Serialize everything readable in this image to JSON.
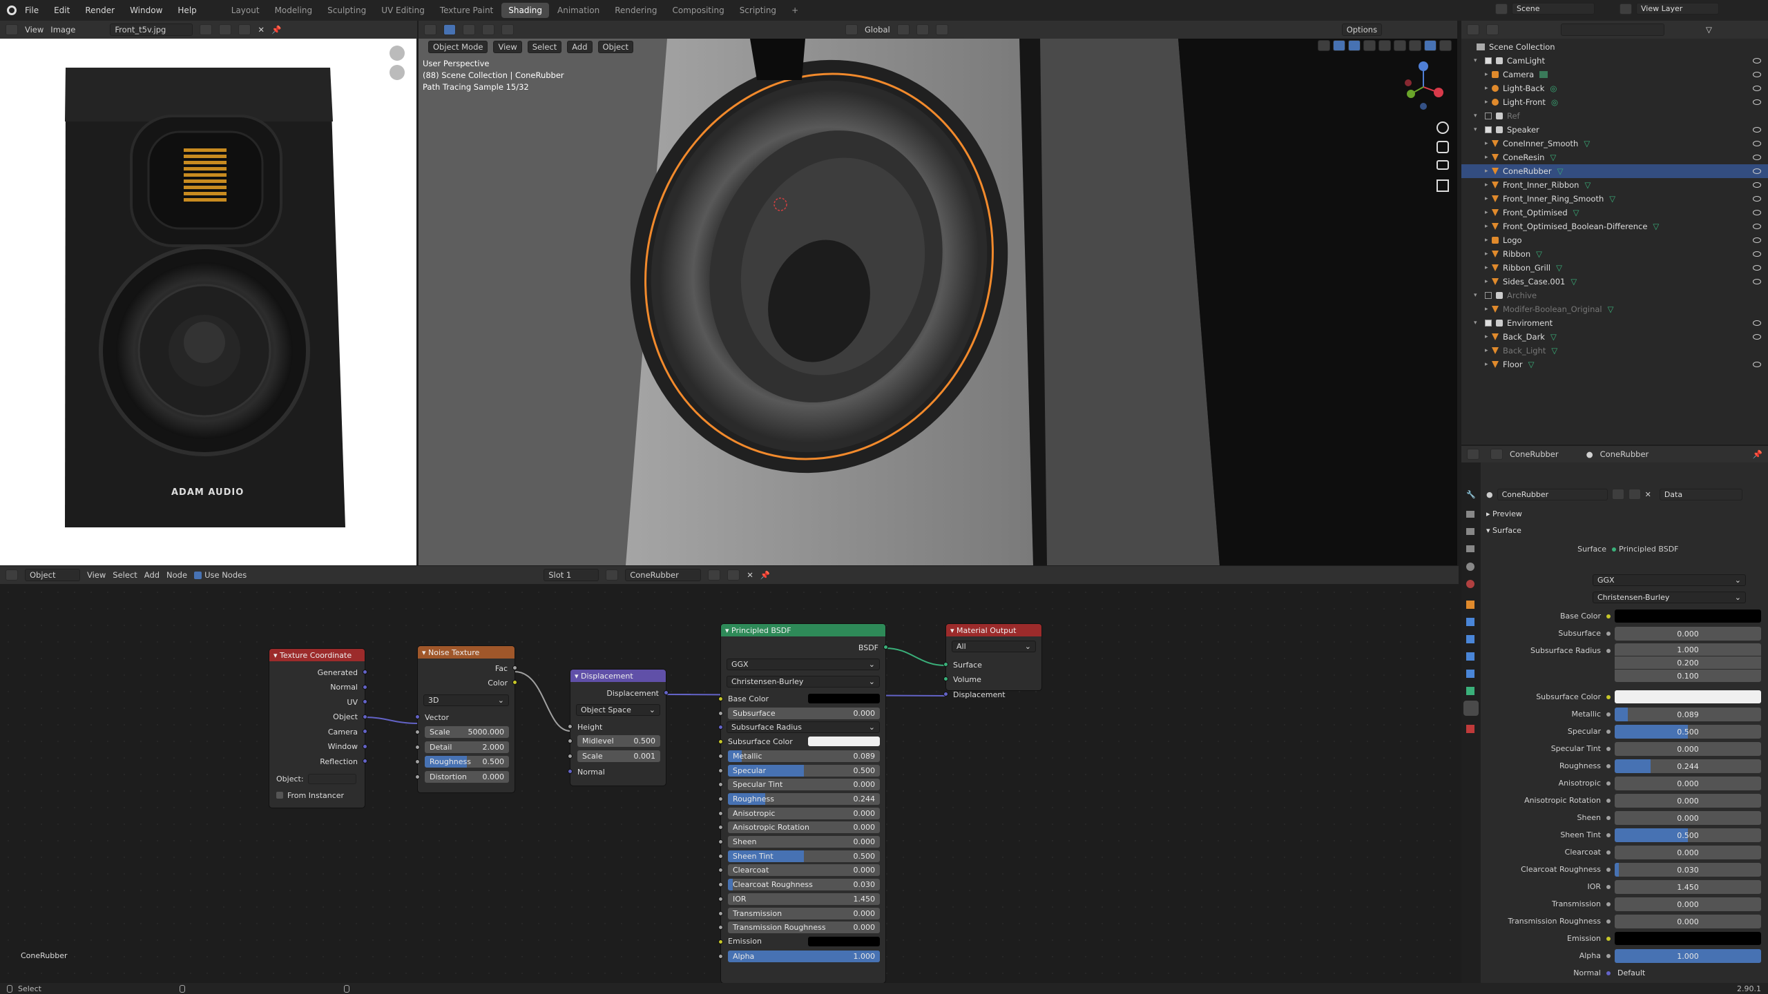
{
  "topbar": {
    "menus": [
      "File",
      "Edit",
      "Render",
      "Window",
      "Help"
    ],
    "workspaces": [
      "Layout",
      "Modeling",
      "Sculpting",
      "UV Editing",
      "Texture Paint",
      "Shading",
      "Animation",
      "Rendering",
      "Compositing",
      "Scripting",
      "+"
    ],
    "active_workspace": "Shading",
    "scene": "Scene",
    "view_layer": "View Layer"
  },
  "image_editor": {
    "view": "View",
    "image": "Image",
    "filename": "Front_t5v.jpg",
    "brand_text": "ADAM AUDIO"
  },
  "viewport": {
    "mode": "Object Mode",
    "menus": [
      "View",
      "Select",
      "Add",
      "Object"
    ],
    "transform": "Global",
    "options": "Options",
    "overlay_lines": [
      "User Perspective",
      "(88) Scene Collection | ConeRubber",
      "Path Tracing Sample 15/32"
    ]
  },
  "outliner": {
    "root": "Scene Collection",
    "items": [
      {
        "label": "CamLight",
        "type": "collection"
      },
      {
        "label": "Camera",
        "type": "camera"
      },
      {
        "label": "Light-Back",
        "type": "light"
      },
      {
        "label": "Light-Front",
        "type": "light"
      },
      {
        "label": "Ref",
        "type": "collection",
        "dim": true
      },
      {
        "label": "Speaker",
        "type": "collection"
      },
      {
        "label": "ConeInner_Smooth",
        "type": "mesh"
      },
      {
        "label": "ConeResin",
        "type": "mesh"
      },
      {
        "label": "ConeRubber",
        "type": "mesh",
        "selected": true
      },
      {
        "label": "Front_Inner_Ribbon",
        "type": "mesh"
      },
      {
        "label": "Front_Inner_Ring_Smooth",
        "type": "mesh"
      },
      {
        "label": "Front_Optimised",
        "type": "mesh"
      },
      {
        "label": "Front_Optimised_Boolean-Difference",
        "type": "mesh"
      },
      {
        "label": "Logo",
        "type": "curve"
      },
      {
        "label": "Ribbon",
        "type": "mesh"
      },
      {
        "label": "Ribbon_Grill",
        "type": "mesh"
      },
      {
        "label": "Sides_Case.001",
        "type": "mesh"
      },
      {
        "label": "Archive",
        "type": "collection",
        "dim": true
      },
      {
        "label": "Modifer-Boolean_Original",
        "type": "mesh",
        "dim": true
      },
      {
        "label": "Enviroment",
        "type": "collection"
      },
      {
        "label": "Back_Dark",
        "type": "mesh"
      },
      {
        "label": "Back_Light",
        "type": "mesh",
        "dim": true
      },
      {
        "label": "Floor",
        "type": "mesh"
      }
    ]
  },
  "properties": {
    "object_name": "ConeRubber",
    "material_name": "ConeRubber",
    "data_label": "Data",
    "sections": [
      "Preview",
      "Surface"
    ],
    "surface_label": "Surface",
    "surface_shader": "Principled BSDF",
    "distribution": "GGX",
    "subsurface_method": "Christensen-Burley",
    "fields": [
      {
        "label": "Base Color",
        "type": "color",
        "color": "#000000"
      },
      {
        "label": "Subsurface",
        "value": "0.000",
        "fraction": 0
      },
      {
        "label": "Subsurface Radius",
        "values": [
          "1.000",
          "0.200",
          "0.100"
        ]
      },
      {
        "label": "Subsurface Color",
        "type": "color",
        "color": "#f0f0f0"
      },
      {
        "label": "Metallic",
        "value": "0.089",
        "fraction": 0.089
      },
      {
        "label": "Specular",
        "value": "0.500",
        "fraction": 0.5
      },
      {
        "label": "Specular Tint",
        "value": "0.000",
        "fraction": 0
      },
      {
        "label": "Roughness",
        "value": "0.244",
        "fraction": 0.244
      },
      {
        "label": "Anisotropic",
        "value": "0.000",
        "fraction": 0
      },
      {
        "label": "Anisotropic Rotation",
        "value": "0.000",
        "fraction": 0
      },
      {
        "label": "Sheen",
        "value": "0.000",
        "fraction": 0
      },
      {
        "label": "Sheen Tint",
        "value": "0.500",
        "fraction": 0.5
      },
      {
        "label": "Clearcoat",
        "value": "0.000",
        "fraction": 0
      },
      {
        "label": "Clearcoat Roughness",
        "value": "0.030",
        "fraction": 0.03
      },
      {
        "label": "IOR",
        "value": "1.450",
        "fraction": 0
      },
      {
        "label": "Transmission",
        "value": "0.000",
        "fraction": 0
      },
      {
        "label": "Transmission Roughness",
        "value": "0.000",
        "fraction": 0
      },
      {
        "label": "Emission",
        "type": "color",
        "color": "#000000"
      },
      {
        "label": "Alpha",
        "value": "1.000",
        "fraction": 1
      },
      {
        "label": "Normal",
        "type": "text",
        "value": "Default"
      }
    ]
  },
  "node_editor": {
    "object_label": "Object",
    "menus": [
      "View",
      "Select",
      "Add",
      "Node"
    ],
    "use_nodes": "Use Nodes",
    "slot": "Slot 1",
    "material": "ConeRubber",
    "footer_label": "ConeRubber",
    "tex_coord": {
      "title": "Texture Coordinate",
      "outputs": [
        "Generated",
        "Normal",
        "UV",
        "Object",
        "Camera",
        "Window",
        "Reflection"
      ],
      "object_label": "Object:",
      "from_instancer": "From Instancer"
    },
    "noise": {
      "title": "Noise Texture",
      "outputs": [
        "Fac",
        "Color"
      ],
      "dimensions": "3D",
      "vector": "Vector",
      "inputs": [
        {
          "label": "Scale",
          "value": "5000.000",
          "fraction": 0
        },
        {
          "label": "Detail",
          "value": "2.000",
          "fraction": 0
        },
        {
          "label": "Roughness",
          "value": "0.500",
          "fraction": 0.5
        },
        {
          "label": "Distortion",
          "value": "0.000",
          "fraction": 0
        }
      ]
    },
    "displacement": {
      "title": "Displacement",
      "output": "Displacement",
      "space": "Object Space",
      "height": "Height",
      "inputs": [
        {
          "label": "Midlevel",
          "value": "0.500"
        },
        {
          "label": "Scale",
          "value": "0.001"
        }
      ],
      "normal": "Normal"
    },
    "bsdf": {
      "title": "Principled BSDF",
      "output": "BSDF",
      "distribution": "GGX",
      "subsurface_method": "Christensen-Burley",
      "rows": [
        {
          "label": "Base Color",
          "type": "color",
          "color": "#000000"
        },
        {
          "label": "Subsurface",
          "value": "0.000",
          "fraction": 0
        },
        {
          "label": "Subsurface Radius",
          "type": "dropdown"
        },
        {
          "label": "Subsurface Color",
          "type": "color",
          "color": "#f0f0f0"
        },
        {
          "label": "Metallic",
          "value": "0.089",
          "fraction": 0.089
        },
        {
          "label": "Specular",
          "value": "0.500",
          "fraction": 0.5
        },
        {
          "label": "Specular Tint",
          "value": "0.000",
          "fraction": 0
        },
        {
          "label": "Roughness",
          "value": "0.244",
          "fraction": 0.244
        },
        {
          "label": "Anisotropic",
          "value": "0.000",
          "fraction": 0
        },
        {
          "label": "Anisotropic Rotation",
          "value": "0.000",
          "fraction": 0
        },
        {
          "label": "Sheen",
          "value": "0.000",
          "fraction": 0
        },
        {
          "label": "Sheen Tint",
          "value": "0.500",
          "fraction": 0.5
        },
        {
          "label": "Clearcoat",
          "value": "0.000",
          "fraction": 0
        },
        {
          "label": "Clearcoat Roughness",
          "value": "0.030",
          "fraction": 0.03
        },
        {
          "label": "IOR",
          "value": "1.450",
          "fraction": 0
        },
        {
          "label": "Transmission",
          "value": "0.000",
          "fraction": 0
        },
        {
          "label": "Transmission Roughness",
          "value": "0.000",
          "fraction": 0
        },
        {
          "label": "Emission",
          "type": "color",
          "color": "#000000"
        },
        {
          "label": "Alpha",
          "value": "1.000",
          "fraction": 1
        }
      ]
    },
    "output": {
      "title": "Material Output",
      "target": "All",
      "inputs": [
        "Surface",
        "Volume",
        "Displacement"
      ]
    }
  },
  "statusbar": {
    "left": "Select",
    "version": "2.90.1"
  },
  "colors": {
    "accent": "#4772b3",
    "selection": "#334d80",
    "orange": "#f28a2c",
    "node_green": "#2e8a58",
    "node_red": "#9c2b2b",
    "node_orange": "#a0572a",
    "node_purple": "#6050a8"
  }
}
